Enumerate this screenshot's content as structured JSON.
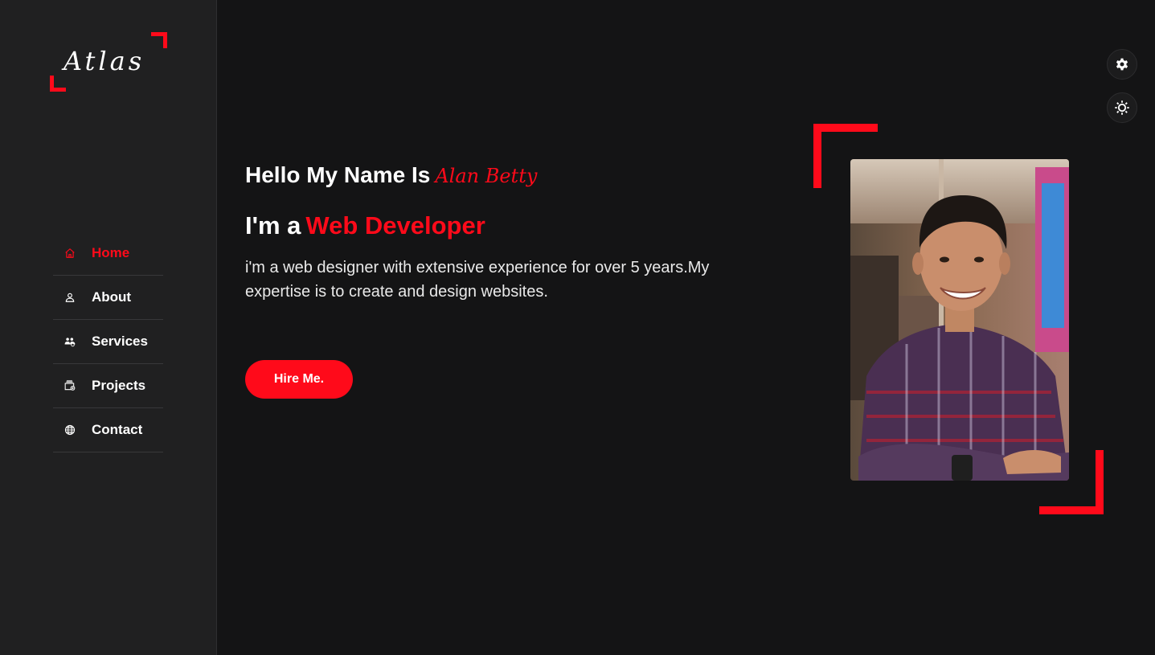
{
  "brand": {
    "logo_text": "Atlas",
    "accent_color": "#ff0a1a"
  },
  "sidebar": {
    "items": [
      {
        "label": "Home",
        "icon": "home-icon",
        "active": true
      },
      {
        "label": "About",
        "icon": "user-icon",
        "active": false
      },
      {
        "label": "Services",
        "icon": "people-icon",
        "active": false
      },
      {
        "label": "Projects",
        "icon": "folder-icon",
        "active": false
      },
      {
        "label": "Contact",
        "icon": "globe-icon",
        "active": false
      }
    ]
  },
  "hero": {
    "greeting": "Hello My Name Is",
    "name": "Alan Betty",
    "role_prefix": "I'm a",
    "role": "Web Developer",
    "description": "i'm a web designer with extensive experience for over 5 years.My expertise is to create and design websites.",
    "cta_label": "Hire Me."
  },
  "portrait": {
    "alt": "portrait photo"
  },
  "toggles": [
    {
      "icon": "gear-icon"
    },
    {
      "icon": "sun-icon"
    }
  ]
}
